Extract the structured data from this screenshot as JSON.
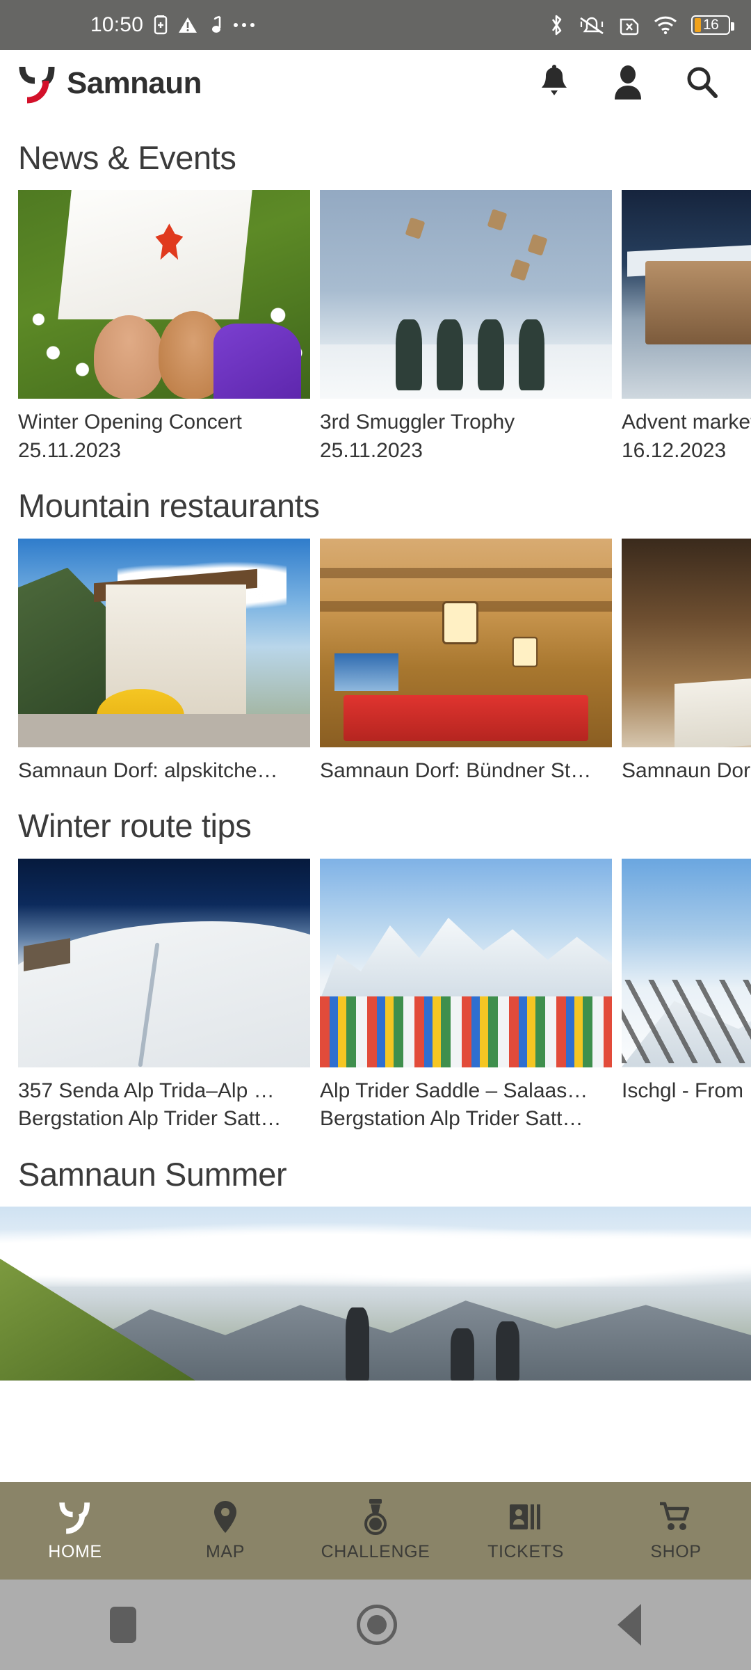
{
  "statusbar": {
    "time": "10:50",
    "battery_percent": "16",
    "left_icons": [
      "sim-card-icon",
      "warning-triangle-icon",
      "music-note-icon",
      "more-dots-icon"
    ],
    "right_icons": [
      "bluetooth-icon",
      "vibrate-off-icon",
      "sim-x-icon",
      "wifi-icon",
      "battery-icon"
    ]
  },
  "appbar": {
    "brand": "Samnaun",
    "logo": "samnaun-logo-icon",
    "actions": [
      {
        "name": "notifications-icon",
        "label": "Notifications"
      },
      {
        "name": "account-icon",
        "label": "Account"
      },
      {
        "name": "search-icon",
        "label": "Search"
      }
    ]
  },
  "sections": [
    {
      "title": "News & Events",
      "cards": [
        {
          "title": "Winter Opening Concert",
          "subtitle": "25.11.2023",
          "photo": "p-grass"
        },
        {
          "title": "3rd Smuggler Trophy",
          "subtitle": "25.11.2023",
          "photo": "p-sky"
        },
        {
          "title": "Advent market",
          "subtitle": "16.12.2023",
          "photo": "p-village"
        }
      ]
    },
    {
      "title": "Mountain restaurants",
      "cards": [
        {
          "title": "Samnaun Dorf: alpskitche…",
          "subtitle": "",
          "photo": "p-hotel"
        },
        {
          "title": "Samnaun Dorf: Bündner St…",
          "subtitle": "",
          "photo": "p-stube"
        },
        {
          "title": "Samnaun Dor",
          "subtitle": "",
          "photo": "p-dine"
        }
      ]
    },
    {
      "title": "Winter route tips",
      "cards": [
        {
          "title": "357 Senda Alp Trida–Alp …",
          "subtitle": "Bergstation Alp Trider Satt…",
          "photo": "p-powder"
        },
        {
          "title": "Alp Trider Saddle – Salaas…",
          "subtitle": "Bergstation Alp Trider Satt…",
          "photo": "p-terrace"
        },
        {
          "title": "Ischgl - From",
          "subtitle": "",
          "photo": "p-sun"
        }
      ]
    },
    {
      "title": "Samnaun Summer",
      "cards": [],
      "banner": {
        "photo": "p-summer",
        "name": "samnaun-summer-banner"
      }
    }
  ],
  "tabbar": {
    "background_color": "#8a8468",
    "active_color": "#ffffff",
    "inactive_color": "#3c3c38",
    "items": [
      {
        "label": "HOME",
        "icon": "samnaun-logo-icon",
        "active": true
      },
      {
        "label": "MAP",
        "icon": "map-pin-icon",
        "active": false
      },
      {
        "label": "CHALLENGE",
        "icon": "medal-icon",
        "active": false
      },
      {
        "label": "TICKETS",
        "icon": "ticket-card-icon",
        "active": false
      },
      {
        "label": "SHOP",
        "icon": "shopping-cart-icon",
        "active": false
      }
    ]
  },
  "navbar": {
    "items": [
      {
        "name": "recent-apps-button",
        "label": "Recents"
      },
      {
        "name": "home-button",
        "label": "Home"
      },
      {
        "name": "back-button",
        "label": "Back"
      }
    ]
  }
}
